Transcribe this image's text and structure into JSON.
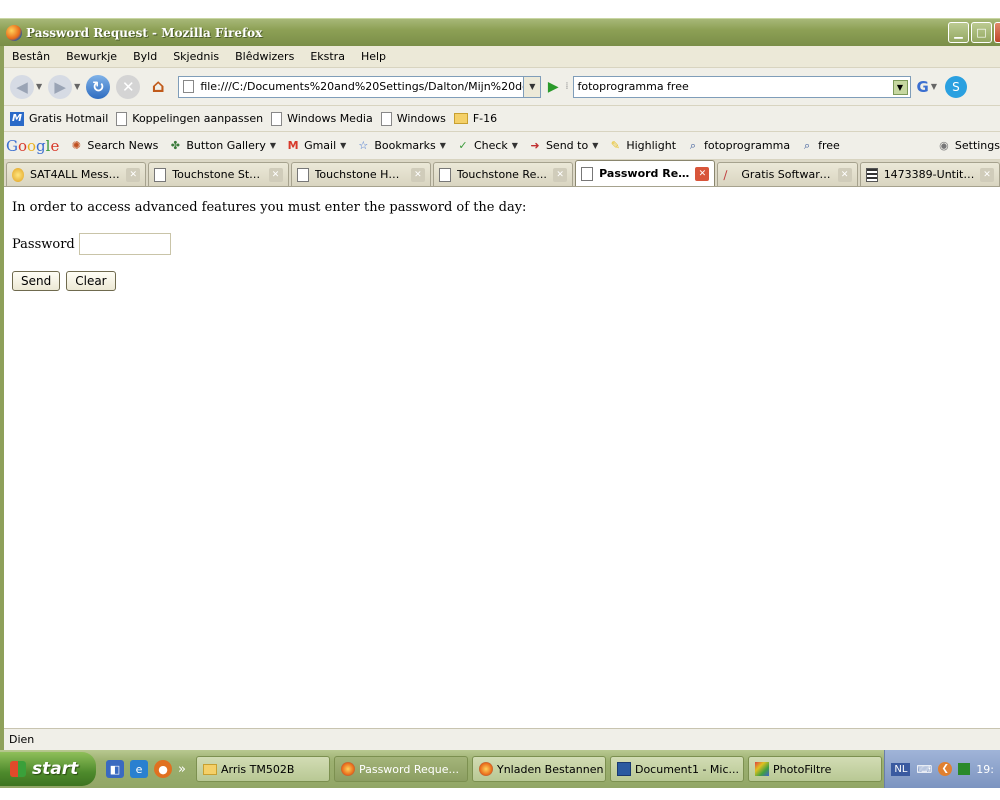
{
  "window": {
    "title": "Password Request - Mozilla Firefox"
  },
  "menu": [
    "Bestân",
    "Bewurkje",
    "Byld",
    "Skjednis",
    "Blêdwizers",
    "Ekstra",
    "Help"
  ],
  "nav": {
    "url": "file:///C:/Documents%20and%20Settings/Dalton/Mijn%20doc",
    "search": "fotoprogramma free",
    "search_engine_label": "G"
  },
  "bookmarks": [
    {
      "label": "Gratis Hotmail",
      "icon": "msn-icon"
    },
    {
      "label": "Koppelingen aanpassen",
      "icon": "page-icon"
    },
    {
      "label": "Windows Media",
      "icon": "page-icon"
    },
    {
      "label": "Windows",
      "icon": "page-icon"
    },
    {
      "label": "F-16",
      "icon": "folder-icon"
    }
  ],
  "google_toolbar": {
    "logo": "Google",
    "items": [
      "Search News",
      "Button Gallery",
      "Gmail",
      "Bookmarks",
      "Check",
      "Send to",
      "Highlight",
      "fotoprogramma",
      "free"
    ],
    "settings": "Settings"
  },
  "tabs": [
    {
      "label": "SAT4ALL Messa...",
      "icon": "bulb",
      "active": false
    },
    {
      "label": "Touchstone Sta...",
      "icon": "page",
      "active": false
    },
    {
      "label": "Touchstone HW...",
      "icon": "page",
      "active": false
    },
    {
      "label": "Touchstone Re...",
      "icon": "page",
      "active": false
    },
    {
      "label": "Password Req...",
      "icon": "page",
      "active": true
    },
    {
      "label": "Gratis Software...",
      "icon": "pen",
      "active": false
    },
    {
      "label": "1473389-Untitl...",
      "icon": "img",
      "active": false
    }
  ],
  "page": {
    "intro": "In order to access advanced features you must enter the password of the day:",
    "password_label": "Password",
    "password_value": "",
    "send_label": "Send",
    "clear_label": "Clear"
  },
  "status": "Dien",
  "taskbar": {
    "start_label": "start",
    "chevron": "»",
    "buttons": [
      {
        "label": "Arris TM502B",
        "active": false
      },
      {
        "label": "Password Reque...",
        "active": true
      },
      {
        "label": "Ynladen Bestannen",
        "active": false
      },
      {
        "label": "Document1 - Mic...",
        "active": false
      },
      {
        "label": "PhotoFiltre",
        "active": false
      }
    ],
    "lang": "NL",
    "clock": "19:"
  },
  "colors": {
    "xp_green": "#8da055",
    "active_tab_close": "#d8553a",
    "start_green": "#4e8a2c"
  }
}
